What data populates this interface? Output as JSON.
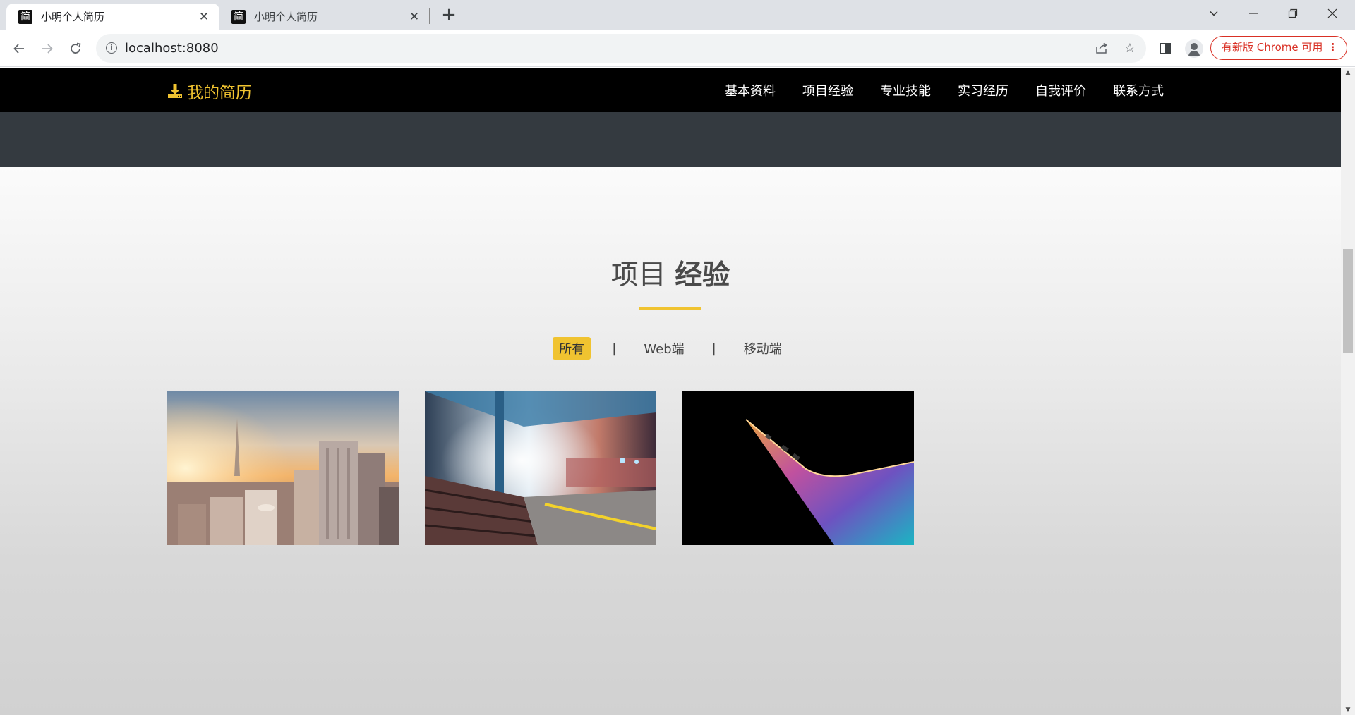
{
  "browser": {
    "tabs": [
      {
        "favicon": "简",
        "title": "小明个人简历",
        "active": true
      },
      {
        "favicon": "简",
        "title": "小明个人简历",
        "active": false
      }
    ],
    "url": "localhost:8080",
    "update_label": "有新版 Chrome 可用"
  },
  "site": {
    "brand": "我的简历",
    "menu": [
      "基本资料",
      "项目经验",
      "专业技能",
      "实习经历",
      "自我评价",
      "联系方式"
    ]
  },
  "section": {
    "title_light": "项目",
    "title_bold": "经验",
    "filters": [
      "所有",
      "Web端",
      "移动端"
    ],
    "separator": "|",
    "active_filter": "所有"
  },
  "gallery": [
    {
      "name": "city-skyline-image"
    },
    {
      "name": "train-station-image"
    },
    {
      "name": "laptop-image"
    }
  ],
  "colors": {
    "accent": "#f0c330",
    "nav_bg": "#000000",
    "hero_bg": "#343a40"
  }
}
